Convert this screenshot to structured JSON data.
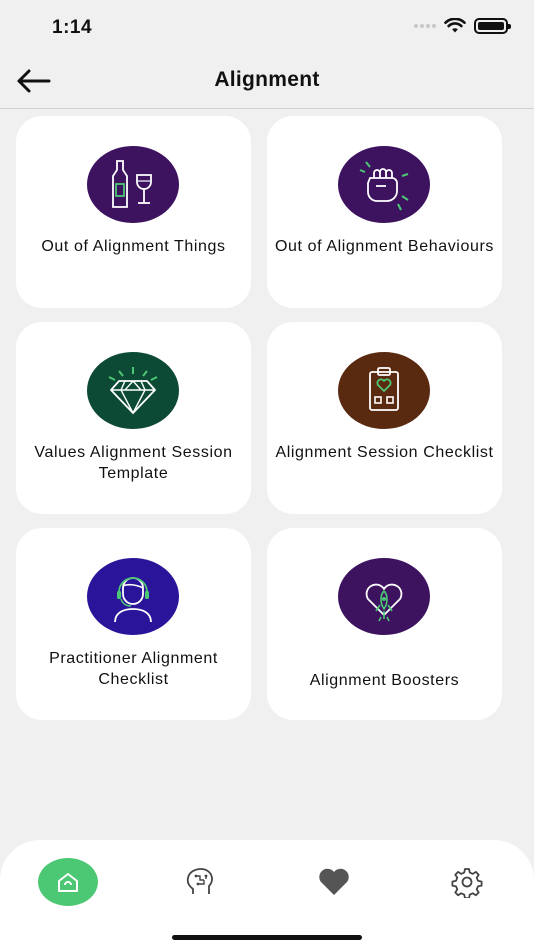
{
  "status": {
    "time": "1:14"
  },
  "header": {
    "title": "Alignment"
  },
  "cards": [
    {
      "label": "Out of Alignment Things",
      "color": "#3d1360",
      "icon": "bottle-glass-icon"
    },
    {
      "label": "Out of Alignment Behaviours",
      "color": "#3d1360",
      "icon": "fist-icon"
    },
    {
      "label": "Values Alignment Session Template",
      "color": "#0d4a35",
      "icon": "diamond-icon"
    },
    {
      "label": "Alignment Session Checklist",
      "color": "#5a2a10",
      "icon": "clipboard-heart-icon"
    },
    {
      "label": "Practitioner Alignment Checklist",
      "color": "#2a1499",
      "icon": "practitioner-headset-icon"
    },
    {
      "label": "Alignment Boosters",
      "color": "#3d1360",
      "icon": "heart-rocket-icon"
    }
  ],
  "tabs": [
    {
      "name": "home-icon",
      "active": true
    },
    {
      "name": "brain-icon",
      "active": false
    },
    {
      "name": "heart-icon",
      "active": false
    },
    {
      "name": "settings-gear-icon",
      "active": false
    }
  ],
  "colors": {
    "accent": "#4cc774",
    "background": "#f0f0f0",
    "card": "#ffffff"
  }
}
